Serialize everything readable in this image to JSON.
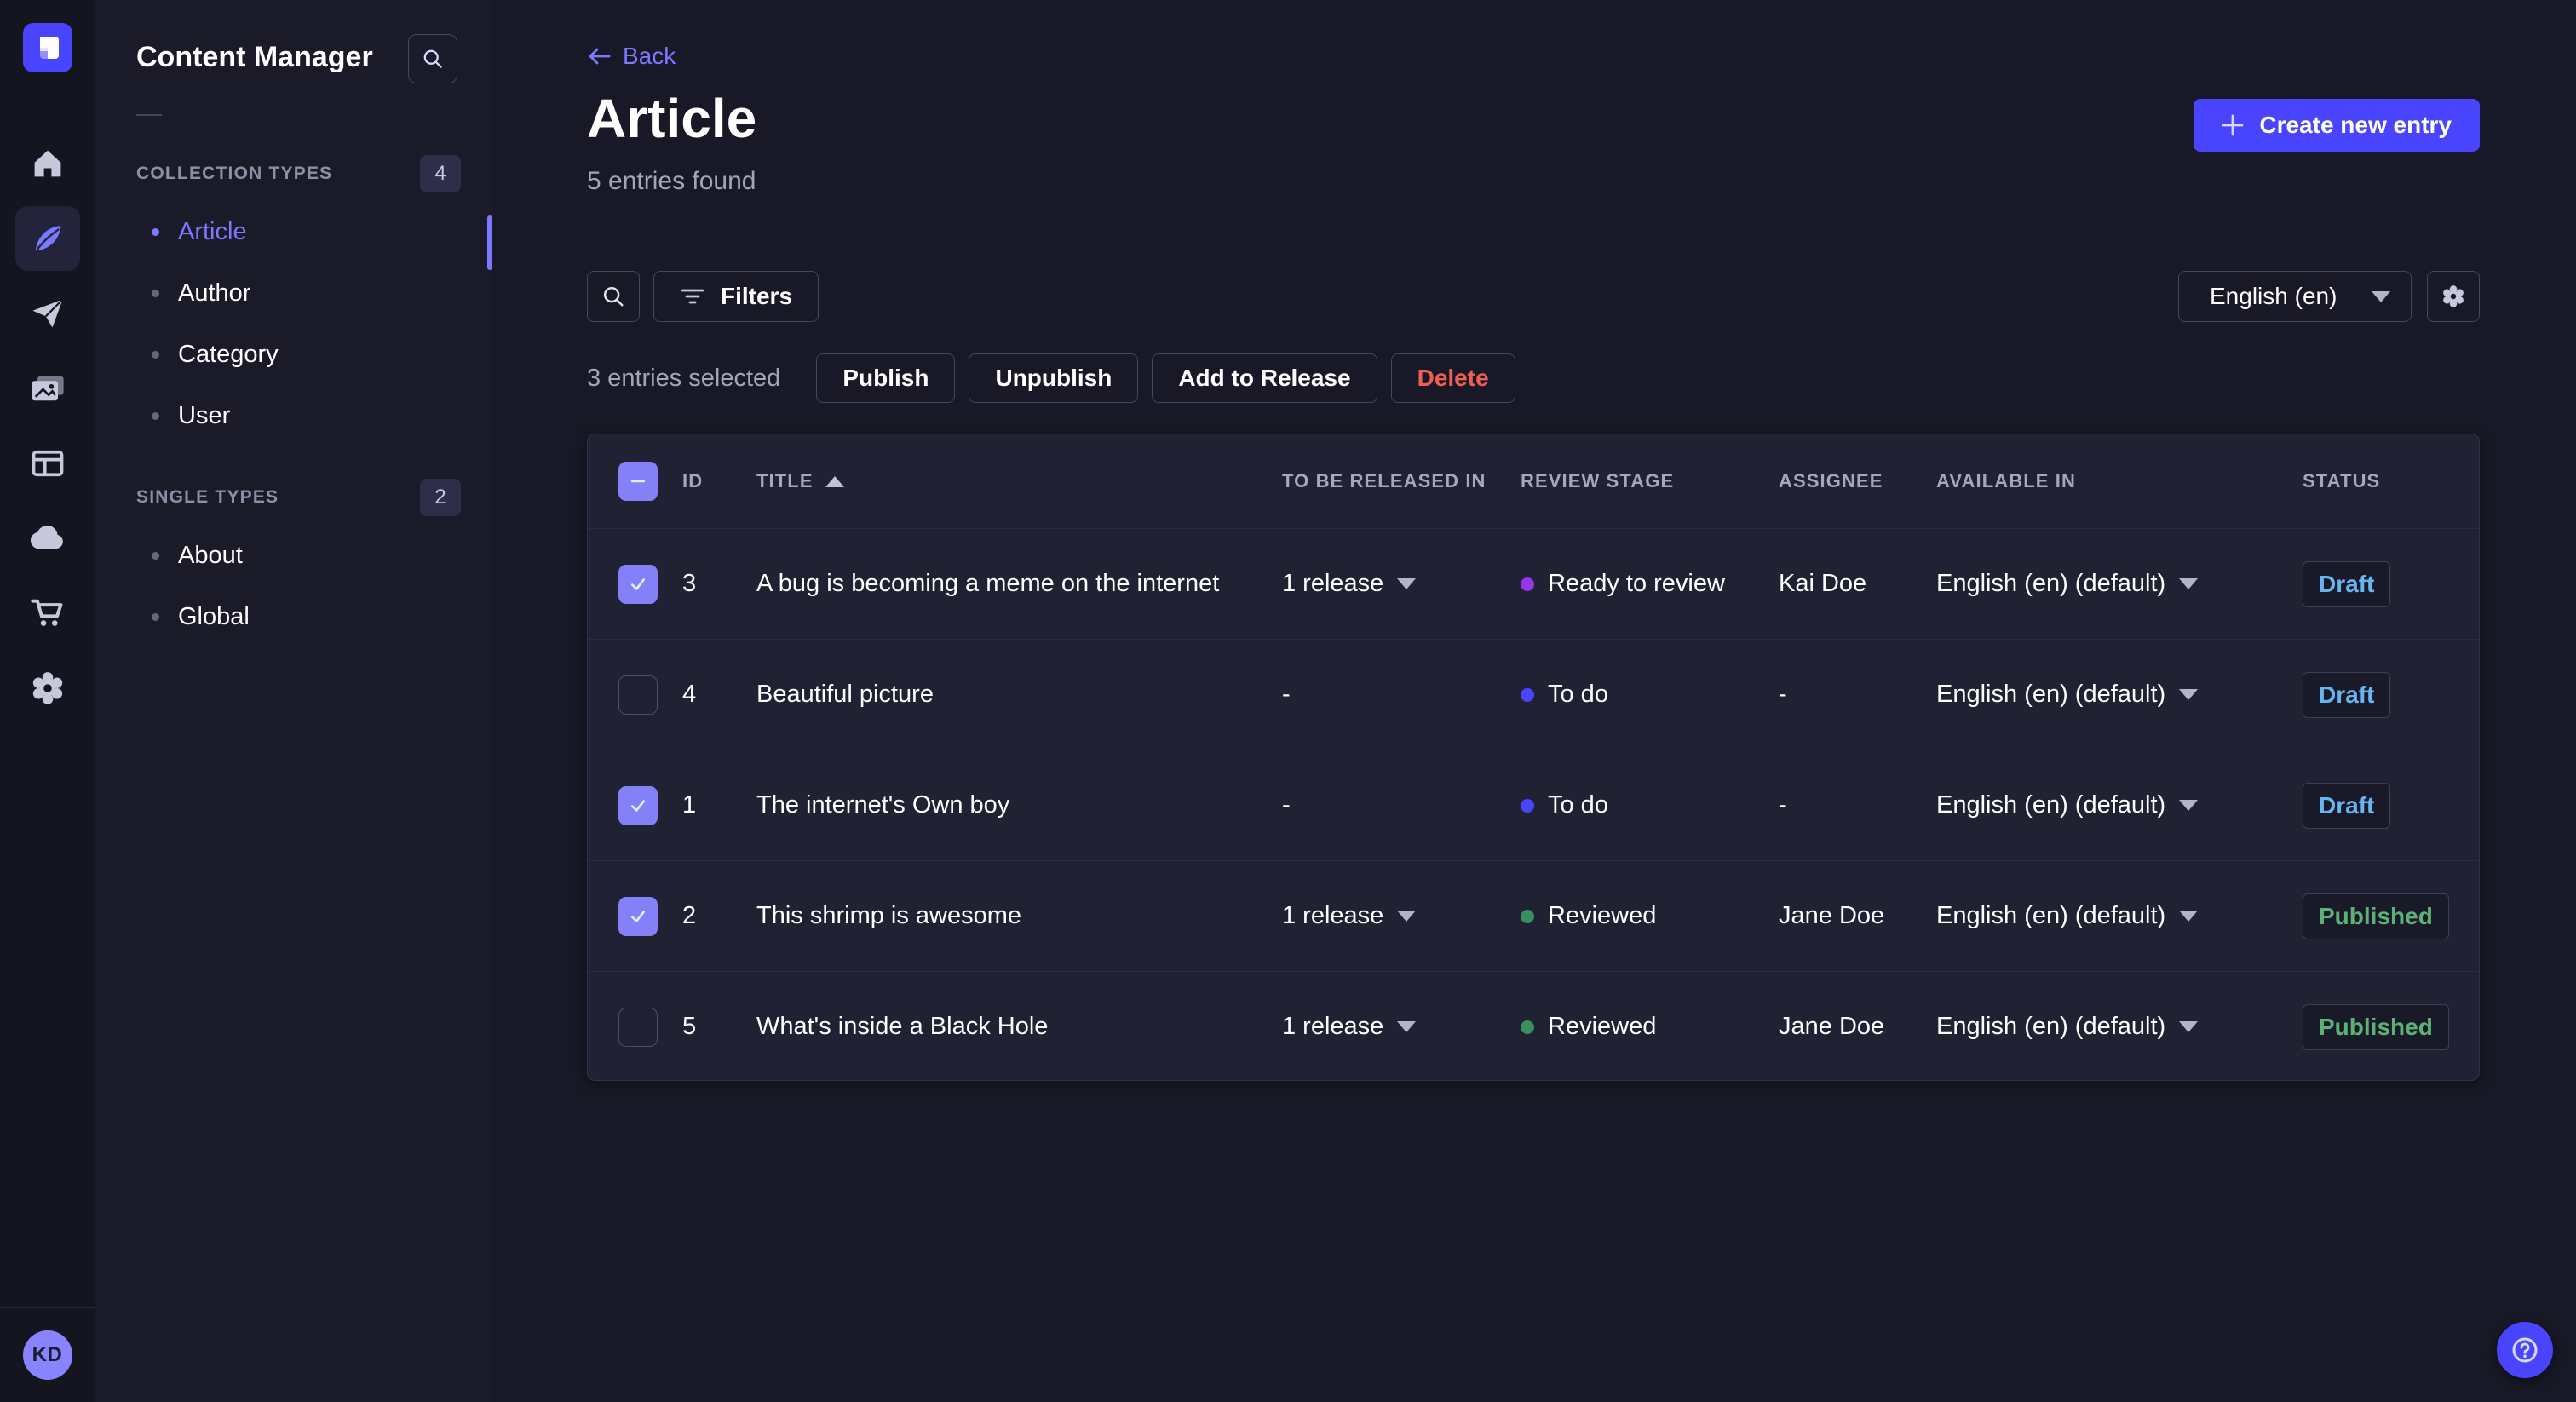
{
  "rail": {
    "icons": [
      "home",
      "content-manager",
      "releases",
      "media-library",
      "content-type-builder",
      "cloud",
      "marketplace",
      "settings"
    ],
    "avatar_initials": "KD"
  },
  "sidebar": {
    "title": "Content Manager",
    "collection_types_label": "COLLECTION TYPES",
    "collection_types_count": "4",
    "single_types_label": "SINGLE TYPES",
    "single_types_count": "2",
    "collection_items": [
      {
        "label": "Article",
        "active": true
      },
      {
        "label": "Author",
        "active": false
      },
      {
        "label": "Category",
        "active": false
      },
      {
        "label": "User",
        "active": false
      }
    ],
    "single_items": [
      {
        "label": "About",
        "active": false
      },
      {
        "label": "Global",
        "active": false
      }
    ]
  },
  "header": {
    "back_label": "Back",
    "title": "Article",
    "subtitle": "5 entries found",
    "create_button_label": "Create new entry"
  },
  "toolbar": {
    "filters_label": "Filters",
    "locale_value": "English (en)"
  },
  "selection": {
    "text": "3 entries selected",
    "publish_label": "Publish",
    "unpublish_label": "Unpublish",
    "add_to_release_label": "Add to Release",
    "delete_label": "Delete"
  },
  "table": {
    "columns": {
      "id": "ID",
      "title": "TITLE",
      "release": "TO BE RELEASED IN",
      "stage": "REVIEW STAGE",
      "assignee": "ASSIGNEE",
      "available": "AVAILABLE IN",
      "status": "STATUS"
    },
    "rows": [
      {
        "checked": true,
        "id": "3",
        "title": "A bug is becoming a meme on the internet",
        "release": "1 release",
        "stage": "Ready to review",
        "stage_key": "ready",
        "assignee": "Kai Doe",
        "locale": "English (en) (default)",
        "status": "Draft"
      },
      {
        "checked": false,
        "id": "4",
        "title": "Beautiful picture",
        "release": "-",
        "stage": "To do",
        "stage_key": "todo",
        "assignee": "-",
        "locale": "English (en) (default)",
        "status": "Draft"
      },
      {
        "checked": true,
        "id": "1",
        "title": "The internet's Own boy",
        "release": "-",
        "stage": "To do",
        "stage_key": "todo",
        "assignee": "-",
        "locale": "English (en) (default)",
        "status": "Draft"
      },
      {
        "checked": true,
        "id": "2",
        "title": "This shrimp is awesome",
        "release": "1 release",
        "stage": "Reviewed",
        "stage_key": "reviewed",
        "assignee": "Jane Doe",
        "locale": "English (en) (default)",
        "status": "Published"
      },
      {
        "checked": false,
        "id": "5",
        "title": "What's inside a Black Hole",
        "release": "1 release",
        "stage": "Reviewed",
        "stage_key": "reviewed",
        "assignee": "Jane Doe",
        "locale": "English (en) (default)",
        "status": "Published"
      }
    ]
  },
  "colors": {
    "bg": "#181826",
    "rail_bg": "#15151f",
    "sidebar_bg": "#1a1a28",
    "panel": "#212134",
    "border": "#32324d",
    "border_light": "#45455f",
    "divider": "#2b2b40",
    "text": "#ffffff",
    "text_muted": "#a5a5ba",
    "text_soft": "#8e8ea9",
    "accent": "#4945ff",
    "accent_light": "#7b79ff",
    "checkbox": "#8481f8",
    "danger": "#ee5e52",
    "stage_todo": "#4945ff",
    "stage_ready": "#9736e8",
    "stage_reviewed": "#37915c",
    "status_draft": "#66b7f1",
    "status_published": "#5cb176",
    "avatar_bg": "#8884ff",
    "badge_bg": "#2e2e48"
  }
}
